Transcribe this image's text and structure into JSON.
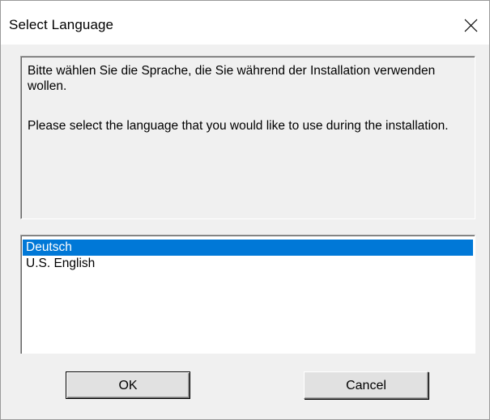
{
  "window": {
    "title": "Select Language",
    "close_icon": "close-icon"
  },
  "message": {
    "german": "Bitte wählen Sie die Sprache, die Sie während der Installation verwenden wollen.",
    "english": "Please select the language that you would like to use during the installation."
  },
  "languages": {
    "items": [
      {
        "label": "Deutsch",
        "selected": true
      },
      {
        "label": "U.S. English",
        "selected": false
      }
    ]
  },
  "buttons": {
    "ok_label": "OK",
    "cancel_label": "Cancel"
  },
  "colors": {
    "selection": "#0078d7",
    "dialog_bg": "#f0f0f0",
    "titlebar_bg": "#ffffff"
  }
}
